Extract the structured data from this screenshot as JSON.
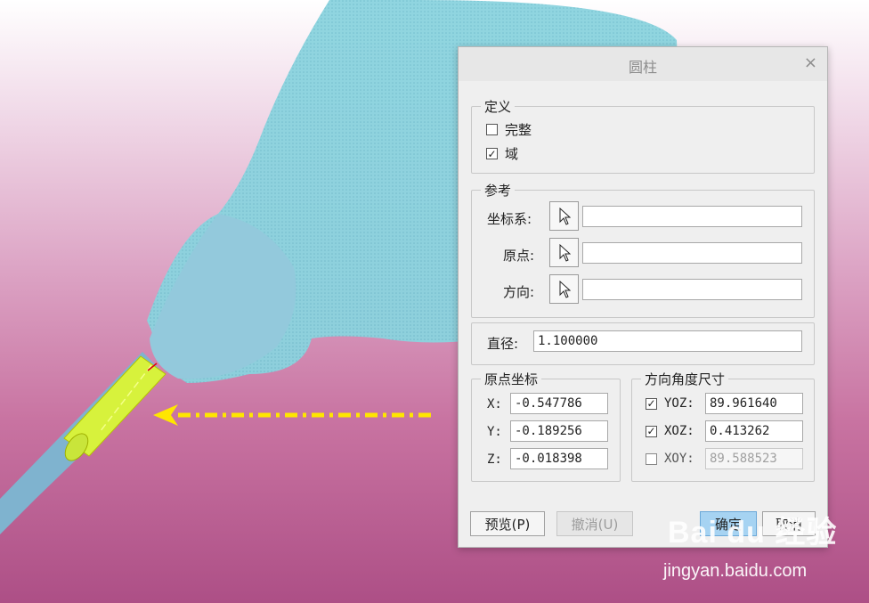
{
  "dialog": {
    "title": "圆柱",
    "close_glyph": "×",
    "definition": {
      "legend": "定义",
      "full": {
        "label": "完整",
        "checked": false
      },
      "domain": {
        "label": "域",
        "checked": true
      }
    },
    "reference": {
      "legend": "参考",
      "coord_sys_label": "坐标系:",
      "origin_label": "原点:",
      "direction_label": "方向:",
      "coord_sys_value": "",
      "origin_value": "",
      "direction_value": "",
      "selector_icon": "cursor-arrow-icon"
    },
    "diameter": {
      "label": "直径:",
      "value": "1.100000"
    },
    "origin_coords": {
      "legend": "原点坐标",
      "x_label": "X:",
      "x_value": "-0.547786",
      "y_label": "Y:",
      "y_value": "-0.189256",
      "z_label": "Z:",
      "z_value": "-0.018398"
    },
    "direction_angles": {
      "legend": "方向角度尺寸",
      "yoz": {
        "label": "YOZ:",
        "value": "89.961640",
        "checked": true
      },
      "xoz": {
        "label": "XOZ:",
        "value": "0.413262",
        "checked": true
      },
      "xoy": {
        "label": "XOY:",
        "value": "89.588523",
        "checked": false
      }
    },
    "buttons": {
      "preview": "预览(P)",
      "undo": "撤消(U)",
      "ok": "确定",
      "cancel": "取消"
    }
  },
  "watermark": {
    "logo_text": "Bai du 经验",
    "url": "jingyan.baidu.com"
  },
  "colors": {
    "model": "#8fd0dc",
    "highlight": "#d7f23c",
    "arrow": "#ffe600",
    "ok_button": "#a6d3f2"
  }
}
